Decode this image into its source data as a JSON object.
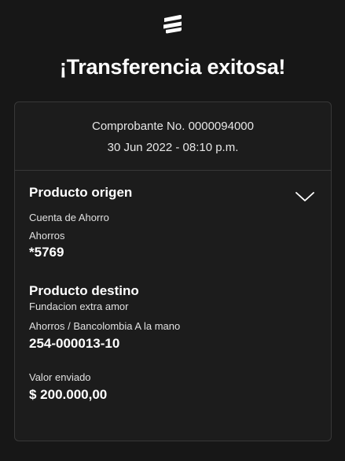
{
  "header": {
    "logo_icon": "bancolombia-logo-icon",
    "title": "¡Transferencia exitosa!"
  },
  "receipt": {
    "voucher": "Comprobante No. 0000094000",
    "datetime": "30 Jun 2022 - 08:10 p.m."
  },
  "origin": {
    "title": "Producto origen",
    "toggle_icon": "chevron-down-icon",
    "account_type": "Cuenta de Ahorro",
    "account_subtype": "Ahorros",
    "account_number": "*5769"
  },
  "destination": {
    "title": "Producto destino",
    "name": "Fundacion extra amor",
    "account": "Ahorros / Bancolombia A la mano",
    "account_number": "254-000013-10"
  },
  "amount": {
    "label": "Valor enviado",
    "value": "$ 200.000,00"
  },
  "colors": {
    "background": "#171717",
    "card": "#1c1c1c",
    "border": "#383838",
    "text": "#ffffff"
  }
}
